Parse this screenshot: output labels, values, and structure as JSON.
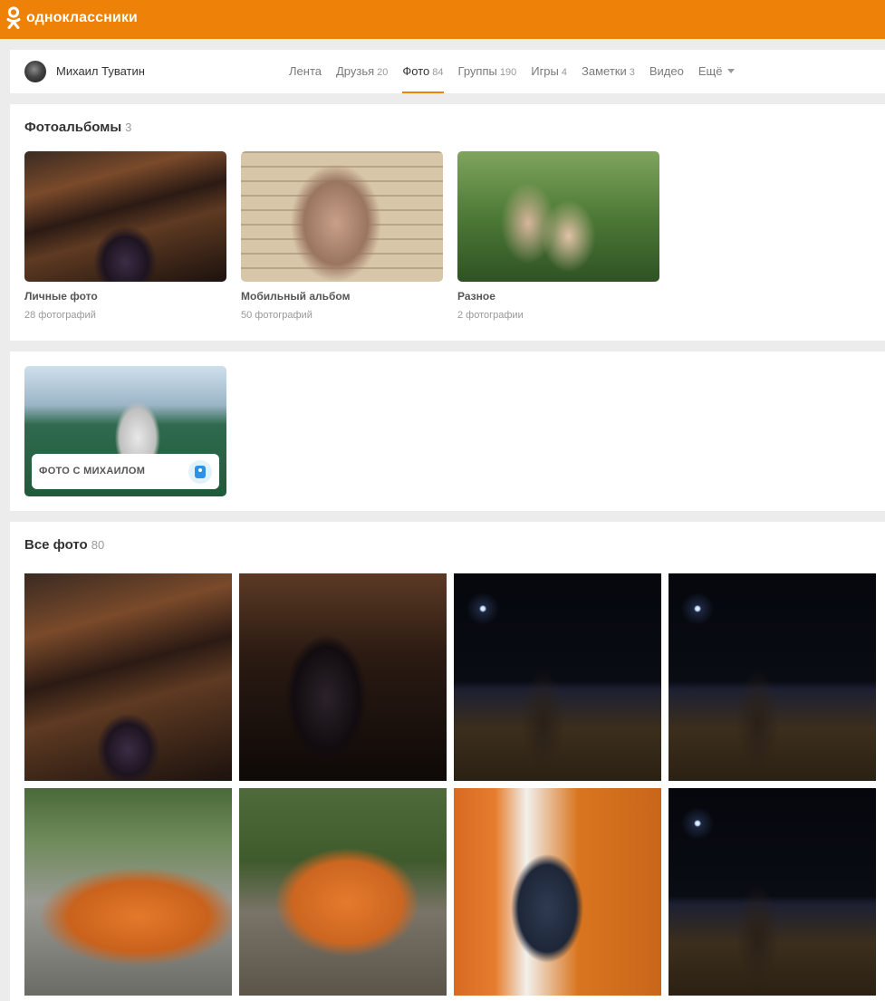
{
  "site": {
    "logo_text": "одноклассники",
    "brand_color": "#ee8208"
  },
  "profile": {
    "name": "Михаил Туватин",
    "tabs": [
      {
        "label": "Лента",
        "count": ""
      },
      {
        "label": "Друзья",
        "count": "20"
      },
      {
        "label": "Фото",
        "count": "84",
        "active": true
      },
      {
        "label": "Группы",
        "count": "190"
      },
      {
        "label": "Игры",
        "count": "4"
      },
      {
        "label": "Заметки",
        "count": "3"
      },
      {
        "label": "Видео",
        "count": ""
      },
      {
        "label": "Ещё",
        "count": ""
      }
    ]
  },
  "albums": {
    "title": "Фотоальбомы",
    "count": "3",
    "items": [
      {
        "name": "Личные фото",
        "photos": "28 фотографий"
      },
      {
        "name": "Мобильный альбом",
        "photos": "50 фотографий"
      },
      {
        "name": "Разное",
        "photos": "2 фотографии"
      }
    ]
  },
  "photo_with": {
    "label": "ФОТО С МИХАИЛОМ"
  },
  "all_photos": {
    "title": "Все фото",
    "count": "80"
  }
}
